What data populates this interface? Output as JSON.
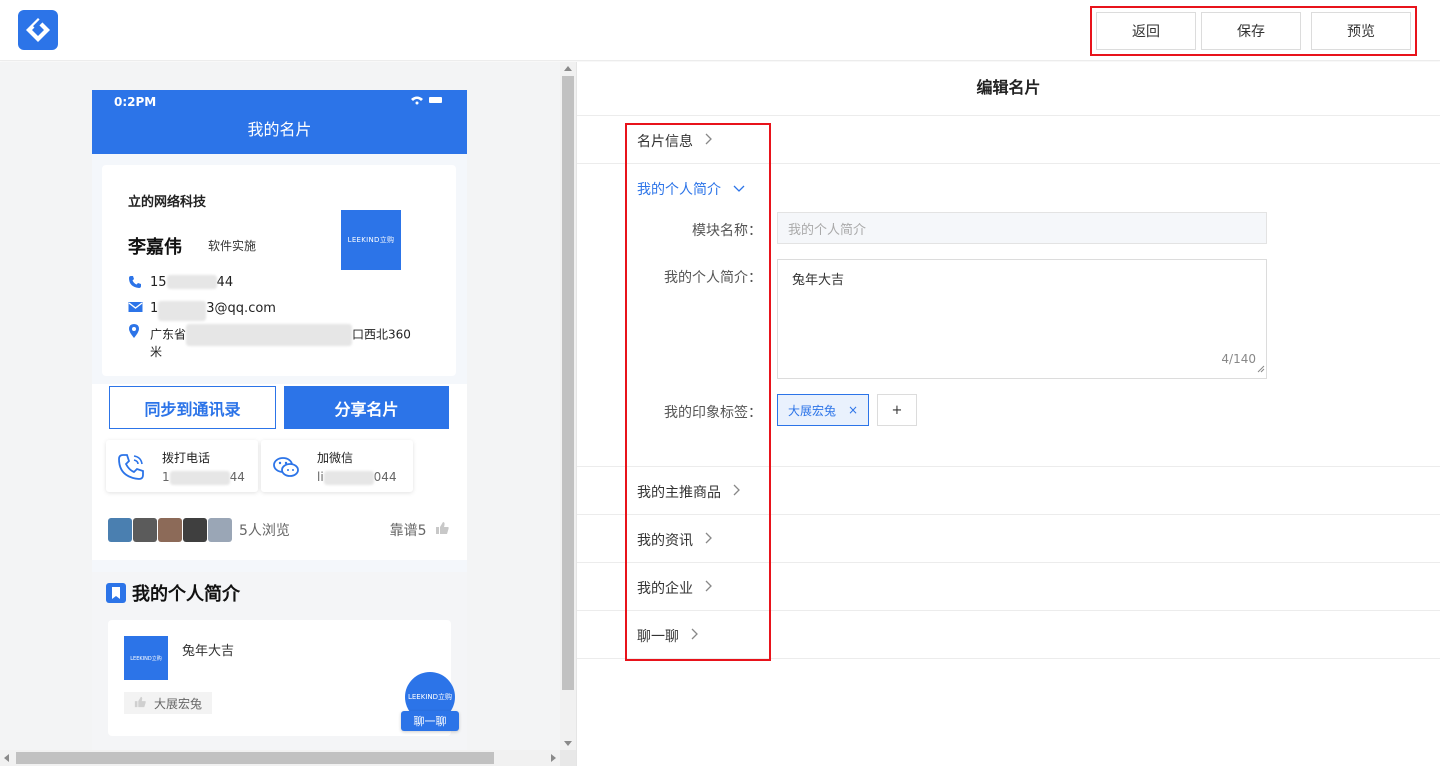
{
  "topbar": {
    "logo_icon": "diamond-logo-icon",
    "buttons": {
      "back": "返回",
      "save": "保存",
      "preview": "预览"
    }
  },
  "preview": {
    "status_time": "0:2PM",
    "status_icons": "wifi battery",
    "header_title": "我的名片",
    "card": {
      "company": "立的网络科技",
      "name": "李嘉伟",
      "job": "软件实施",
      "logo_text": "LEEKIND立购",
      "phone_prefix": "15",
      "phone_suffix": "44",
      "email_prefix": "1",
      "email_suffix": "3@qq.com",
      "address_prefix": "广东省",
      "address_suffix": "口西北360",
      "address_line2": "米"
    },
    "sync_button": "同步到通讯录",
    "share_button": "分享名片",
    "call": {
      "title": "拨打电话",
      "value_prefix": "1",
      "value_suffix": "44"
    },
    "wechat": {
      "title": "加微信",
      "value_prefix": "li",
      "value_suffix": "044"
    },
    "viewers_text": "5人浏览",
    "likes_text": "靠谱5",
    "intro": {
      "title": "我的个人简介",
      "content": "兔年大吉",
      "tag": "大展宏兔",
      "logo_text": "LEEKIND立购"
    },
    "chat_logo_text": "LEEKIND立购",
    "chat_button": "聊一聊"
  },
  "editor": {
    "title": "编辑名片",
    "sections": {
      "card_info": "名片信息",
      "intro": "我的个人简介",
      "products": "我的主推商品",
      "news": "我的资讯",
      "enterprise": "我的企业",
      "chat": "聊一聊"
    },
    "form": {
      "module_name_label": "模块名称：",
      "module_name_value": "我的个人简介",
      "intro_label": "我的个人简介：",
      "intro_value": "兔年大吉",
      "intro_count": "4/140",
      "tags_label": "我的印象标签：",
      "tag_value": "大展宏兔",
      "tag_remove": "×",
      "add_tag": "+"
    }
  },
  "colors": {
    "primary": "#2c74e8",
    "highlight": "#e8131b"
  }
}
